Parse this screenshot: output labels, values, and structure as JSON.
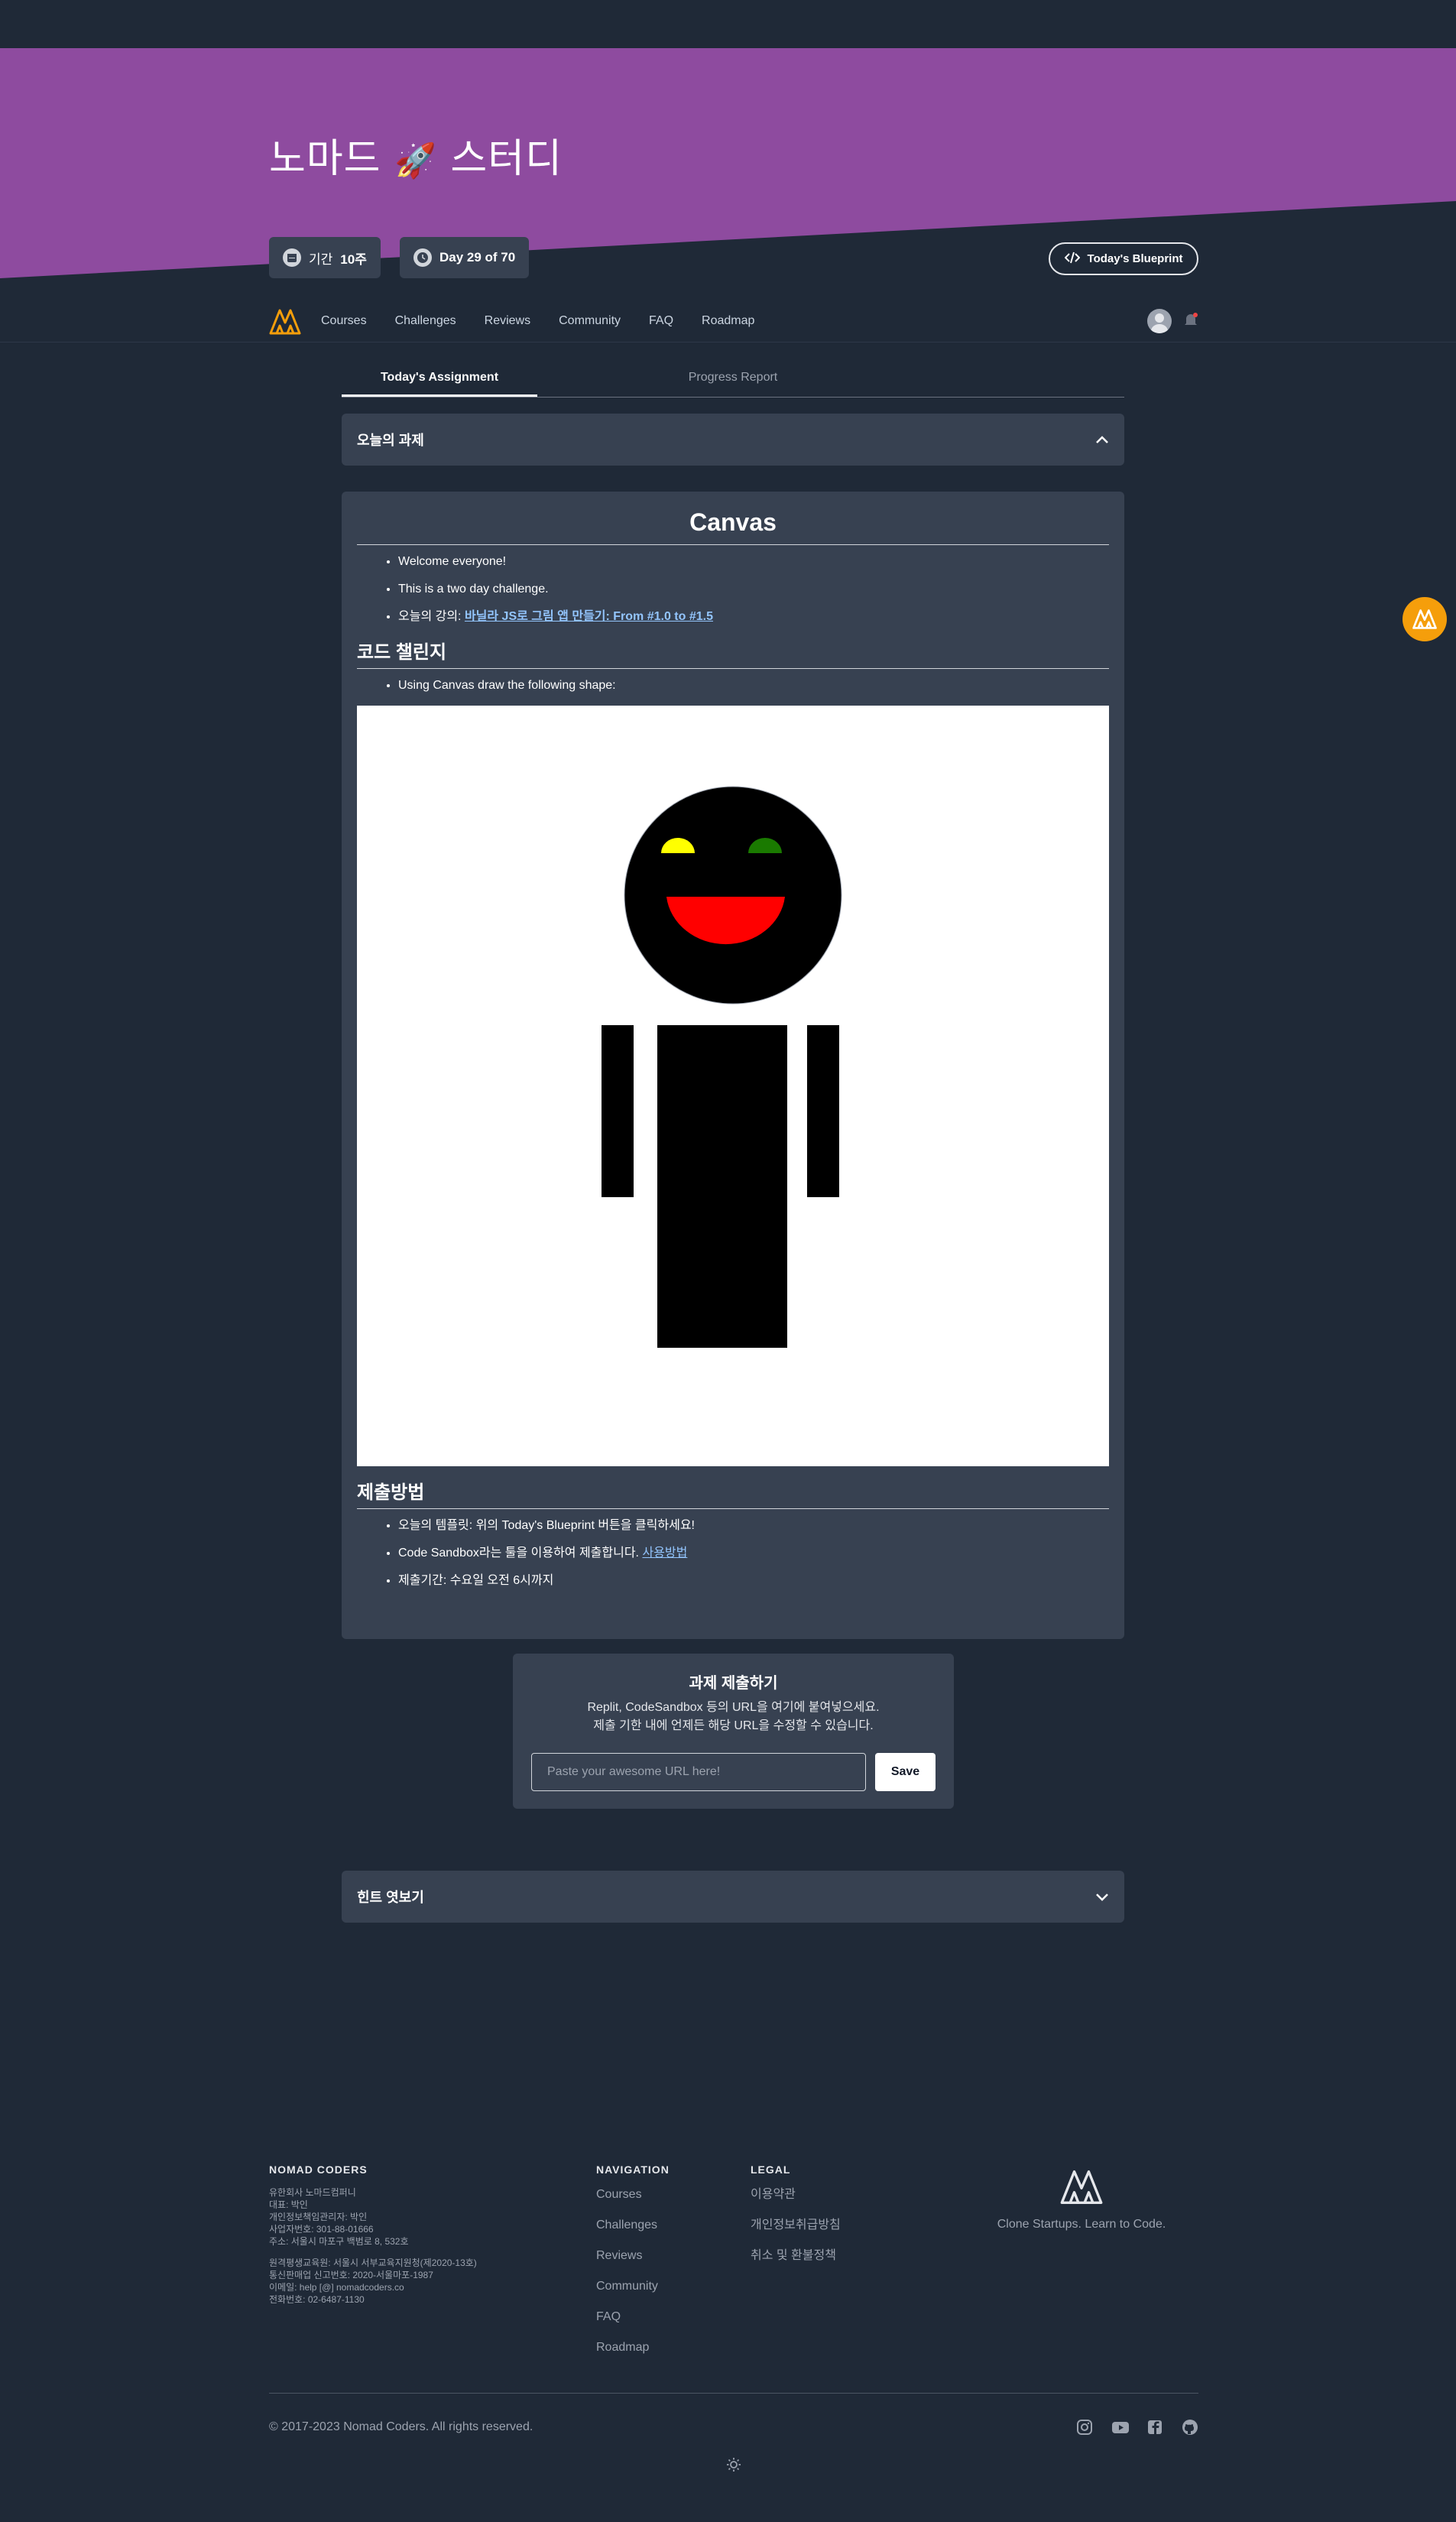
{
  "hero": {
    "title_prefix": "노마드",
    "title_rocket": "🚀",
    "title_suffix": "스터디",
    "duration_label": "기간",
    "duration_value": "10주",
    "day_label": "Day 29 of 70",
    "blueprint_button": "Today's Blueprint"
  },
  "nav": {
    "items": [
      "Courses",
      "Challenges",
      "Reviews",
      "Community",
      "FAQ",
      "Roadmap"
    ]
  },
  "tabs": [
    "Today's Assignment",
    "Progress Report"
  ],
  "assignment_accordion": "오늘의 과제",
  "content": {
    "title": "Canvas",
    "intro": [
      "Welcome everyone!",
      "This is a two day challenge."
    ],
    "lecture_prefix": "오늘의 강의:",
    "lecture_link": "바닐라 JS로 그림 앱 만들기: From #1.0 to #1.5",
    "challenge_heading": "코드 챌린지",
    "challenge_item": "Using Canvas draw the following shape:",
    "submit_heading": "제출방법",
    "submit_items": [
      "오늘의 템플릿: 위의 Today's Blueprint 버튼을 클릭하세요!"
    ],
    "sandbox_text": "Code Sandbox라는 툴을 이용하여 제출합니다.",
    "sandbox_link": "사용방법",
    "deadline": "제출기간: 수요일 오전 6시까지"
  },
  "submit": {
    "title": "과제 제출하기",
    "line1": "Replit, CodeSandbox 등의 URL을 여기에 붙여넣으세요.",
    "line2": "제출 기한 내에 언제든 해당 URL을 수정할 수 있습니다.",
    "placeholder": "Paste your awesome URL here!",
    "save": "Save"
  },
  "hint_accordion": "힌트 엿보기",
  "footer": {
    "company": "NOMAD CODERS",
    "company_lines_1": [
      "유한회사 노마드컴퍼니",
      "대표: 박인",
      "개인정보책임관리자: 박인",
      "사업자번호: 301-88-01666",
      "주소: 서울시 마포구 백범로 8, 532호"
    ],
    "company_lines_2": [
      "원격평생교육원: 서울시 서부교육지원청(제2020-13호)",
      "통신판매업 신고번호: 2020-서울마포-1987",
      "이메일: help [@] nomadcoders.co",
      "전화번호: 02-6487-1130"
    ],
    "navigation_heading": "NAVIGATION",
    "navigation_links": [
      "Courses",
      "Challenges",
      "Reviews",
      "Community",
      "FAQ",
      "Roadmap"
    ],
    "legal_heading": "LEGAL",
    "legal_links": [
      "이용약관",
      "개인정보취급방침",
      "취소 및 환불정책"
    ],
    "tagline": "Clone Startups. Learn to Code.",
    "copyright": "© 2017-2023 Nomad Coders. All rights reserved."
  },
  "colors": {
    "hero_purple": "#8e4b9f",
    "background": "#1f2937",
    "card": "#374151",
    "accent_orange": "#f59e0b"
  }
}
